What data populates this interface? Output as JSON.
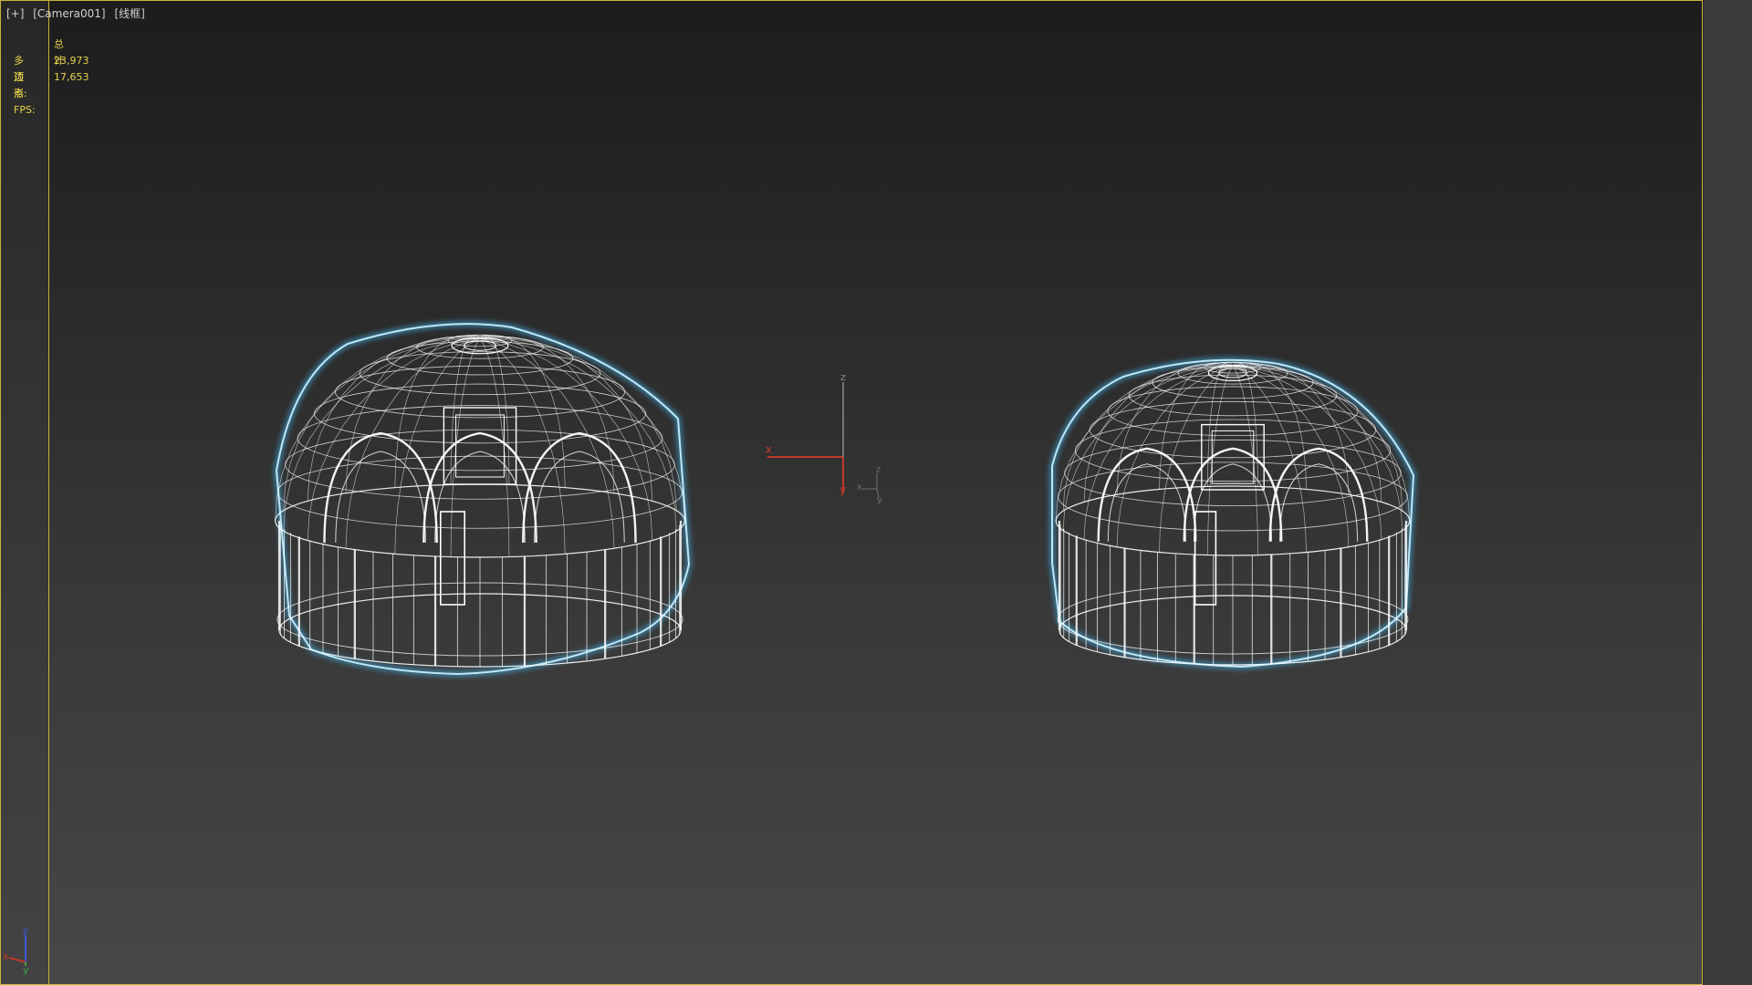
{
  "viewport": {
    "labels": [
      "[+]",
      "[Camera001]",
      "[线框]"
    ],
    "stats": {
      "heading": "总计",
      "rows": [
        {
          "key": "多边形:",
          "value": "23,973"
        },
        {
          "key": "顶点:",
          "value": "17,653"
        }
      ],
      "fps_label": "FPS:"
    },
    "render_mode": "wireframe",
    "colors": {
      "frame_border": "#c8b43a",
      "wire": "#ffffff",
      "selection_halo": "#3fa3d4",
      "axis_x": "#c0392b",
      "axis_y": "#c0392b",
      "axis_z": "#9a9a9a",
      "stats_text": "#e6d24b"
    },
    "gizmo_labels": {
      "x": "x",
      "y": "y",
      "z": "z"
    },
    "corner_axis_labels": {
      "x": "x",
      "y": "y",
      "z": "z"
    }
  }
}
